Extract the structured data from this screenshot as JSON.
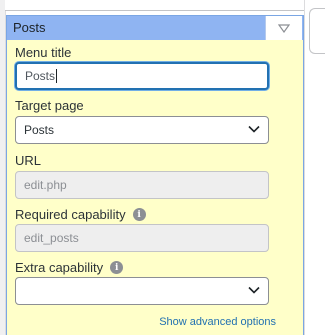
{
  "panel": {
    "title": "Posts",
    "toggle_icon": "triangle-down-icon"
  },
  "fields": {
    "menu_title": {
      "label": "Menu title",
      "value": "Posts"
    },
    "target_page": {
      "label": "Target page",
      "value": "Posts"
    },
    "url": {
      "label": "URL",
      "value": "edit.php"
    },
    "required_capability": {
      "label": "Required capability",
      "value": "edit_posts"
    },
    "extra_capability": {
      "label": "Extra capability",
      "value": ""
    }
  },
  "links": {
    "advanced": "Show advanced options"
  },
  "colors": {
    "panel_bg": "#ffffc9",
    "header_bg": "#8fb4f2",
    "focus_border": "#2271b1",
    "link": "#2271b1"
  }
}
